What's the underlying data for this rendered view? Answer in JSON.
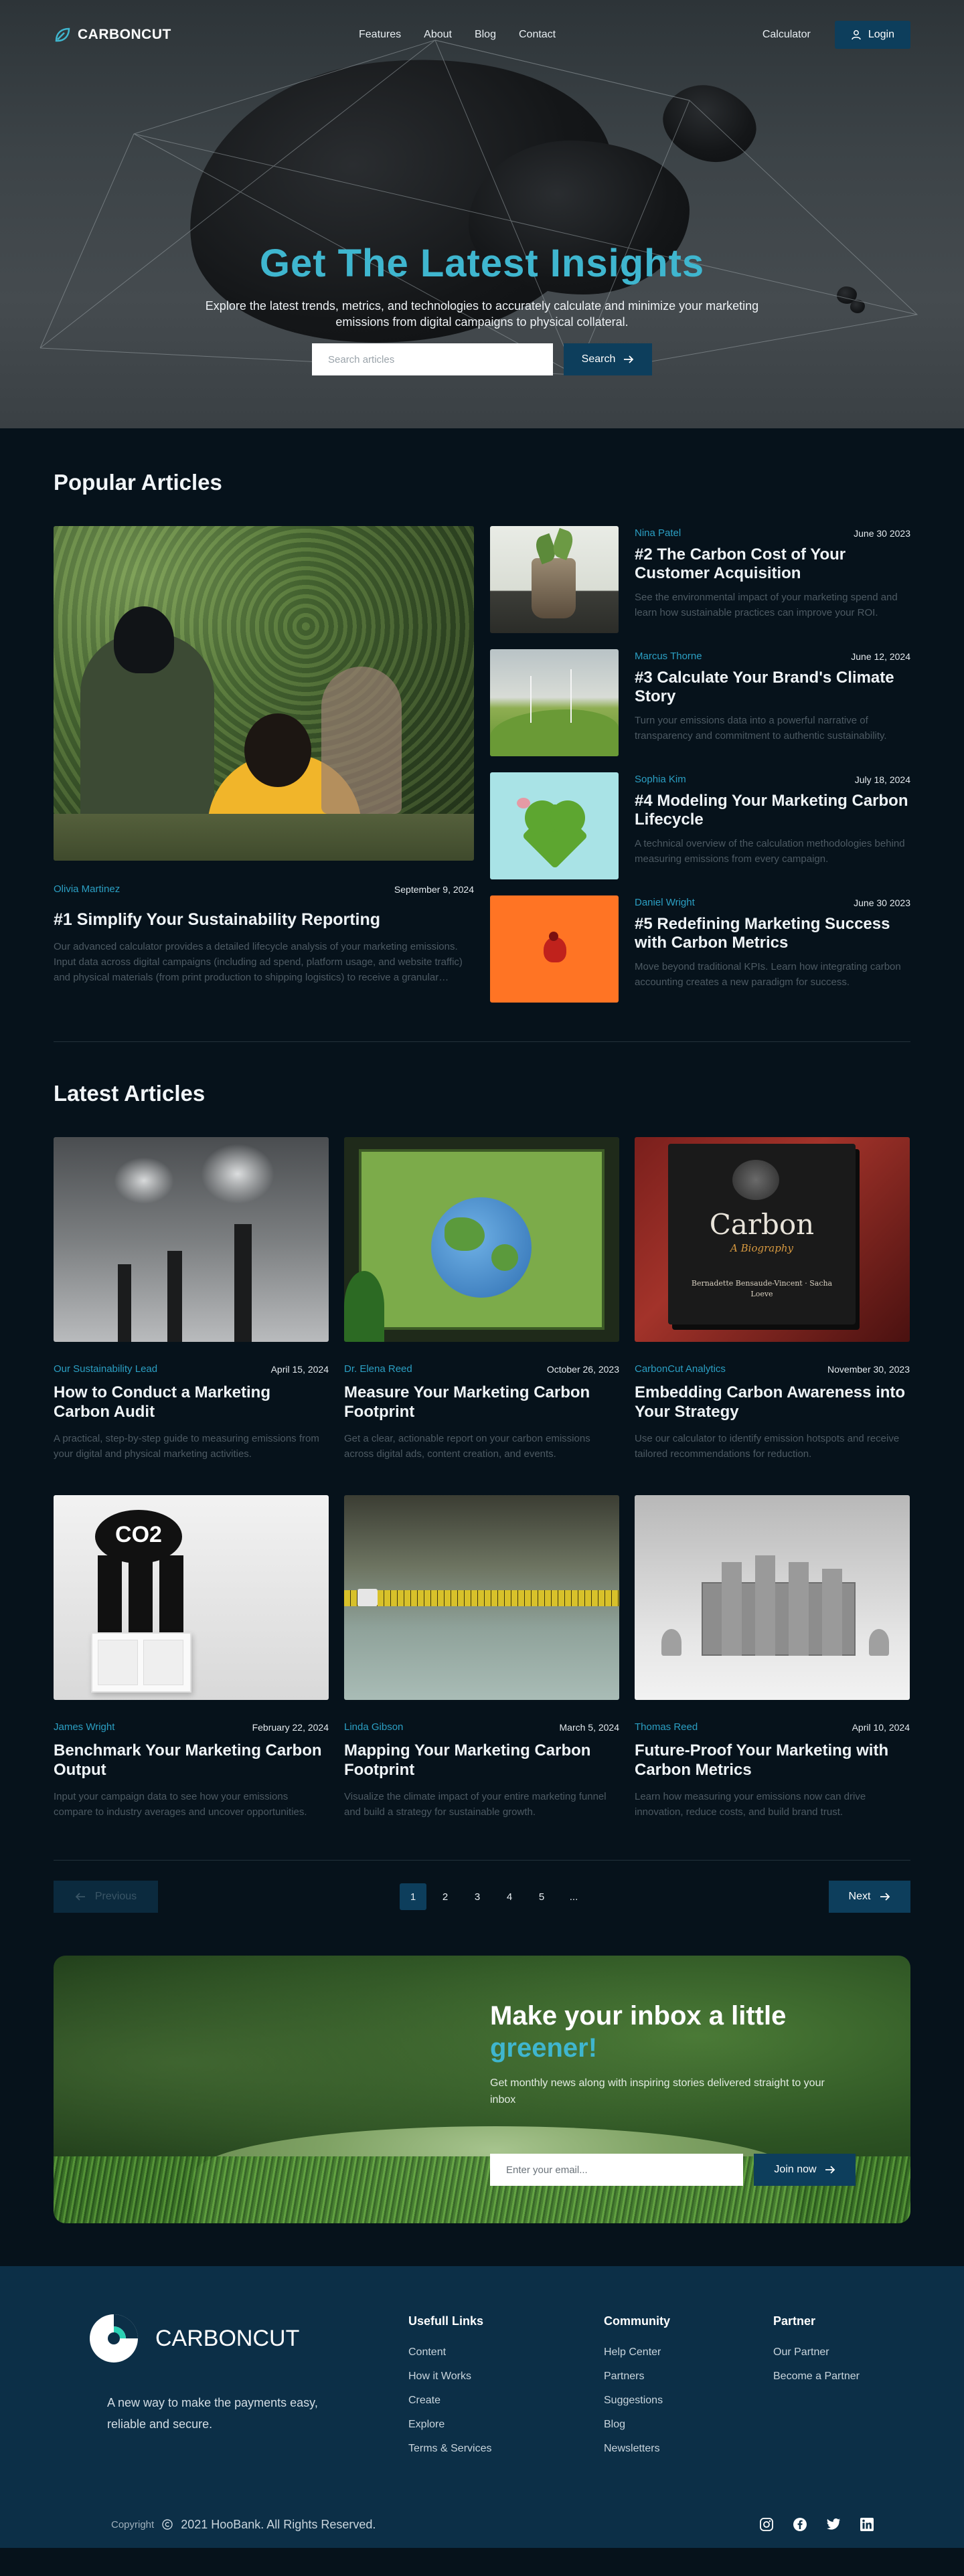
{
  "nav": {
    "brand": "CARBONCUT",
    "links": [
      "Features",
      "About",
      "Blog",
      "Contact"
    ],
    "calculator": "Calculator",
    "login": "Login"
  },
  "hero": {
    "title": "Get The Latest Insights",
    "subtitle": "Explore the latest trends, metrics, and technologies to accurately calculate and minimize your marketing emissions from digital campaigns to physical collateral.",
    "search_placeholder": "Search articles",
    "search_button": "Search"
  },
  "popular": {
    "title": "Popular Articles",
    "feature": {
      "author": "Olivia Martinez",
      "date": "September 9, 2024",
      "title": "#1 Simplify Your Sustainability Reporting",
      "desc": "Our advanced calculator provides a detailed lifecycle analysis of your marketing emissions. Input data across digital campaigns (including ad spend, platform usage, and website traffic) and physical materials (from print production to shipping logistics) to receive a granular breakdown of your carbon footprint."
    },
    "items": [
      {
        "author": "Nina Patel",
        "date": "June 30 2023",
        "title": "#2 The Carbon Cost of Your Customer Acquisition",
        "desc": "See the environmental impact of your marketing spend and learn how sustainable practices can improve your ROI."
      },
      {
        "author": "Marcus Thorne",
        "date": "June 12, 2024",
        "title": "#3 Calculate Your Brand's Climate Story",
        "desc": "Turn your emissions data into a powerful narrative of transparency and commitment to authentic sustainability."
      },
      {
        "author": "Sophia Kim",
        "date": "July 18, 2024",
        "title": "#4 Modeling Your Marketing Carbon Lifecycle",
        "desc": "A technical overview of the calculation methodologies behind measuring emissions from every campaign."
      },
      {
        "author": "Daniel Wright",
        "date": "June 30 2023",
        "title": "#5 Redefining Marketing Success with Carbon Metrics",
        "desc": "Move beyond traditional KPIs. Learn how integrating carbon accounting creates a new paradigm for success."
      }
    ]
  },
  "latest": {
    "title": "Latest Articles",
    "cards": [
      {
        "author": "Our Sustainability Lead",
        "date": "April 15, 2024",
        "title": "How to Conduct a Marketing Carbon Audit",
        "desc": "A practical, step-by-step guide to measuring emissions from your digital and physical marketing activities."
      },
      {
        "author": "Dr. Elena Reed",
        "date": "October 26, 2023",
        "title": "Measure Your Marketing Carbon Footprint",
        "desc": "Get a clear, actionable report on your carbon emissions across digital ads, content creation, and events."
      },
      {
        "author": "CarbonCut Analytics",
        "date": "November 30, 2023",
        "title": "Embedding Carbon Awareness into Your Strategy",
        "desc": "Use our calculator to identify emission hotspots and receive tailored recommendations for reduction."
      },
      {
        "author": "James Wright",
        "date": "February 22, 2024",
        "title": "Benchmark Your Marketing Carbon Output",
        "desc": "Input your campaign data to see how your emissions compare to industry averages and uncover opportunities."
      },
      {
        "author": "Linda Gibson",
        "date": "March 5, 2024",
        "title": "Mapping Your Marketing Carbon Footprint",
        "desc": "Visualize the climate impact of your entire marketing funnel and build a strategy for sustainable growth."
      },
      {
        "author": "Thomas Reed",
        "date": "April 10, 2024",
        "title": "Future-Proof Your Marketing with Carbon Metrics",
        "desc": "Learn how measuring your emissions now can drive innovation, reduce costs, and build brand trust."
      }
    ],
    "image_texts": {
      "book_title": "Carbon",
      "book_subtitle": "A Biography",
      "book_authors": "Bernadette Bensaude-Vincent · Sacha Loeve",
      "co2": "CO2"
    }
  },
  "pagination": {
    "prev": "Previous",
    "next": "Next",
    "pages": [
      "1",
      "2",
      "3",
      "4",
      "5",
      "..."
    ]
  },
  "newsletter": {
    "title_a": "Make your inbox a little",
    "title_b": "greener!",
    "subtitle": "Get monthly news along with inspiring stories delivered straight to your inbox",
    "placeholder": "Enter your email...",
    "button": "Join now"
  },
  "footer": {
    "brand": "CARBONCUT",
    "tagline": "A new way to make the payments easy, reliable and secure.",
    "cols": [
      {
        "title": "Usefull Links",
        "items": [
          "Content",
          "How it Works",
          "Create",
          "Explore",
          "Terms & Services"
        ]
      },
      {
        "title": "Community",
        "items": [
          "Help Center",
          "Partners",
          "Suggestions",
          "Blog",
          "Newsletters"
        ]
      },
      {
        "title": "Partner",
        "items": [
          "Our Partner",
          "Become a Partner"
        ]
      }
    ],
    "copyright_label": "Copyright",
    "copyright": "2021 HooBank. All Rights Reserved.",
    "socials": [
      "instagram-icon",
      "facebook-icon",
      "twitter-icon",
      "linkedin-icon"
    ]
  },
  "colors": {
    "accent": "#3fb6cf",
    "button": "#0d3e5c",
    "background": "#06121b",
    "footer": "#0c2f47"
  }
}
